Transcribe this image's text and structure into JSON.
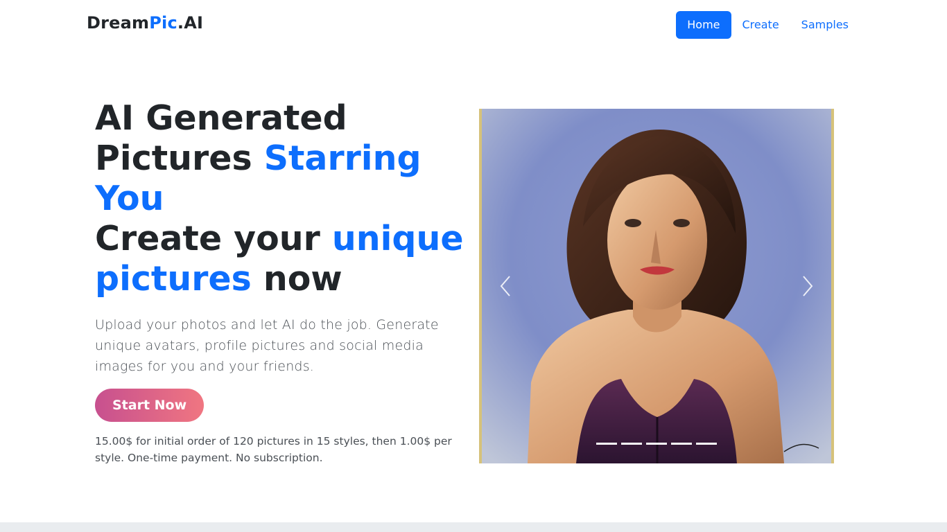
{
  "brand": {
    "part1": "Dream",
    "part2": "Pic",
    "part3": ".AI"
  },
  "nav": {
    "items": [
      {
        "label": "Home",
        "active": true
      },
      {
        "label": "Create",
        "active": false
      },
      {
        "label": "Samples",
        "active": false
      }
    ]
  },
  "hero": {
    "headline_line1": "AI Generated Pictures ",
    "headline_accent1": "Starring You",
    "headline_line2": "Create your ",
    "headline_accent2": "unique pictures",
    "headline_line2_end": " now",
    "lead": "Upload your photos and let AI do the job. Generate unique avatars, profile pictures and social media images for you and your friends.",
    "cta_label": "Start Now",
    "pricing": "15.00$ for initial order of 120 pictures in 15 styles, then 1.00$ per style. One-time payment. No subscription."
  },
  "carousel": {
    "slide_count": 5,
    "active_index": 0,
    "image_alt": "impressionist portrait of a woman"
  },
  "colors": {
    "accent": "#0d6efd",
    "cta_start": "#c7508f",
    "cta_end": "#f07681",
    "text": "#212529"
  },
  "icons": {
    "prev": "chevron-left-icon",
    "next": "chevron-right-icon"
  }
}
